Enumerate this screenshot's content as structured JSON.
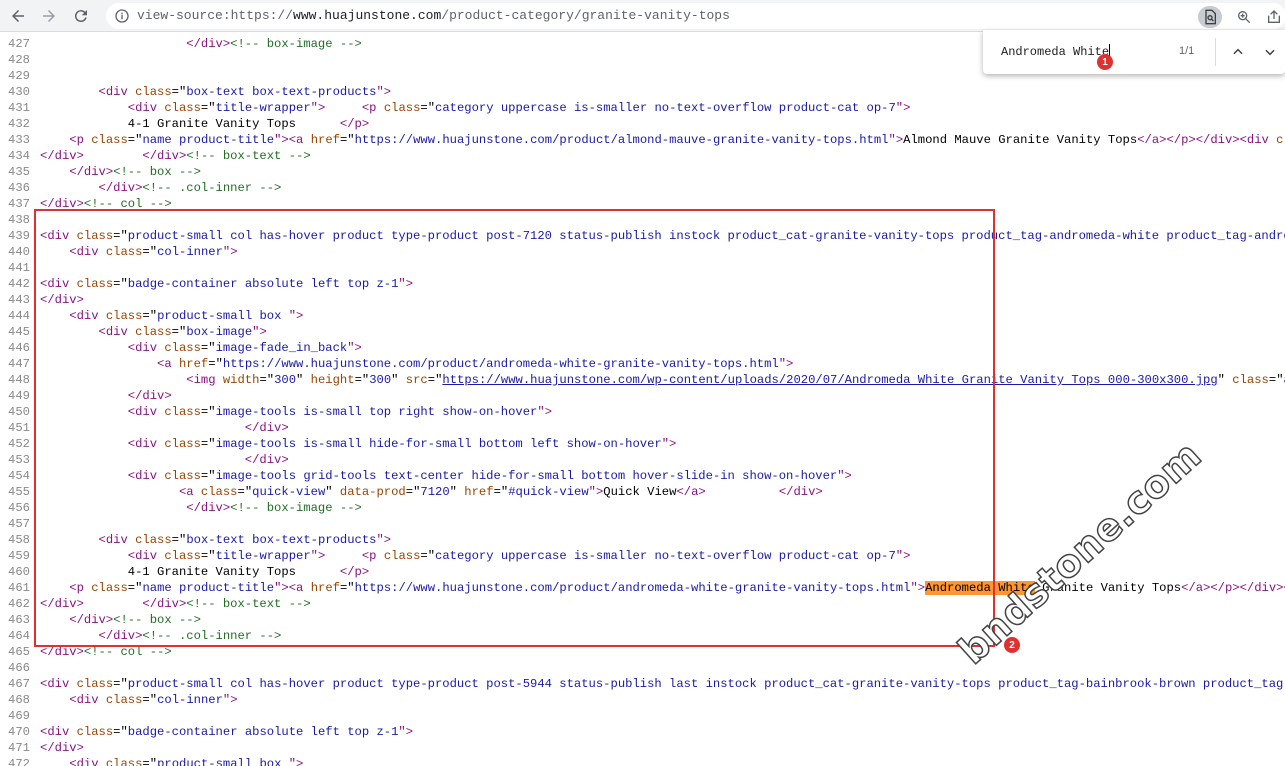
{
  "browser": {
    "url_prefix": "view-source:https://",
    "url_host": "www.huajunstone.com",
    "url_path": "/product-category/granite-vanity-tops"
  },
  "find_bar": {
    "query": "Andromeda White",
    "count": "1/1"
  },
  "annotations": {
    "marker_1": "1",
    "marker_2": "2",
    "watermark": "bndstone.com"
  },
  "source_lines": [
    {
      "num": "427",
      "segs": [
        {
          "s": "                    "
        },
        {
          "s": "</div>",
          "c": "t"
        },
        {
          "s": "<!-- box-image -->",
          "c": "c"
        }
      ]
    },
    {
      "num": "428",
      "segs": []
    },
    {
      "num": "429",
      "segs": []
    },
    {
      "num": "430",
      "segs": [
        {
          "s": "        "
        },
        {
          "s": "<div ",
          "c": "t"
        },
        {
          "s": "class",
          "c": "a"
        },
        {
          "s": "=\""
        },
        {
          "s": "box-text box-text-products",
          "c": "v"
        },
        {
          "s": "\">",
          "c": "t"
        }
      ]
    },
    {
      "num": "431",
      "segs": [
        {
          "s": "            "
        },
        {
          "s": "<div ",
          "c": "t"
        },
        {
          "s": "class",
          "c": "a"
        },
        {
          "s": "=\""
        },
        {
          "s": "title-wrapper",
          "c": "v"
        },
        {
          "s": "\">",
          "c": "t"
        },
        {
          "s": "     "
        },
        {
          "s": "<p ",
          "c": "t"
        },
        {
          "s": "class",
          "c": "a"
        },
        {
          "s": "=\""
        },
        {
          "s": "category uppercase is-smaller no-text-overflow product-cat op-7",
          "c": "v"
        },
        {
          "s": "\">",
          "c": "t"
        }
      ]
    },
    {
      "num": "432",
      "segs": [
        {
          "s": "            4-1 Granite Vanity Tops      "
        },
        {
          "s": "</p>",
          "c": "t"
        }
      ]
    },
    {
      "num": "433",
      "segs": [
        {
          "s": "    "
        },
        {
          "s": "<p ",
          "c": "t"
        },
        {
          "s": "class",
          "c": "a"
        },
        {
          "s": "=\""
        },
        {
          "s": "name product-title",
          "c": "v"
        },
        {
          "s": "\">",
          "c": "t"
        },
        {
          "s": "<a ",
          "c": "t"
        },
        {
          "s": "href",
          "c": "a"
        },
        {
          "s": "=\""
        },
        {
          "s": "https://www.huajunstone.com/product/almond-mauve-granite-vanity-tops.html",
          "c": "v"
        },
        {
          "s": "\">",
          "c": "t"
        },
        {
          "s": "Almond Mauve Granite Vanity Tops"
        },
        {
          "s": "</a></p></div>",
          "c": "t"
        },
        {
          "s": "<div ",
          "c": "t"
        },
        {
          "s": "class",
          "c": "a"
        },
        {
          "s": "=\""
        },
        {
          "s": "pr",
          "c": "v"
        }
      ]
    },
    {
      "num": "434",
      "segs": [
        {
          "s": "</div>",
          "c": "t"
        },
        {
          "s": "        "
        },
        {
          "s": "</div>",
          "c": "t"
        },
        {
          "s": "<!-- box-text -->",
          "c": "c"
        }
      ]
    },
    {
      "num": "435",
      "segs": [
        {
          "s": "    "
        },
        {
          "s": "</div>",
          "c": "t"
        },
        {
          "s": "<!-- box -->",
          "c": "c"
        }
      ]
    },
    {
      "num": "436",
      "segs": [
        {
          "s": "        "
        },
        {
          "s": "</div>",
          "c": "t"
        },
        {
          "s": "<!-- .col-inner -->",
          "c": "c"
        }
      ]
    },
    {
      "num": "437",
      "segs": [
        {
          "s": "</div>",
          "c": "t"
        },
        {
          "s": "<!-- col -->",
          "c": "c"
        }
      ]
    },
    {
      "num": "438",
      "segs": []
    },
    {
      "num": "439",
      "segs": [
        {
          "s": "<div ",
          "c": "t"
        },
        {
          "s": "class",
          "c": "a"
        },
        {
          "s": "=\""
        },
        {
          "s": "product-small col has-hover product type-product post-7120 status-publish instock product_cat-granite-vanity-tops product_tag-andromeda-white product_tag-andromeda-wh",
          "c": "v"
        }
      ]
    },
    {
      "num": "440",
      "segs": [
        {
          "s": "    "
        },
        {
          "s": "<div ",
          "c": "t"
        },
        {
          "s": "class",
          "c": "a"
        },
        {
          "s": "=\""
        },
        {
          "s": "col-inner",
          "c": "v"
        },
        {
          "s": "\">",
          "c": "t"
        }
      ]
    },
    {
      "num": "441",
      "segs": []
    },
    {
      "num": "442",
      "segs": [
        {
          "s": "<div ",
          "c": "t"
        },
        {
          "s": "class",
          "c": "a"
        },
        {
          "s": "=\""
        },
        {
          "s": "badge-container absolute left top z-1",
          "c": "v"
        },
        {
          "s": "\">",
          "c": "t"
        }
      ]
    },
    {
      "num": "443",
      "segs": [
        {
          "s": "</div>",
          "c": "t"
        }
      ]
    },
    {
      "num": "444",
      "segs": [
        {
          "s": "    "
        },
        {
          "s": "<div ",
          "c": "t"
        },
        {
          "s": "class",
          "c": "a"
        },
        {
          "s": "=\""
        },
        {
          "s": "product-small box ",
          "c": "v"
        },
        {
          "s": "\">",
          "c": "t"
        }
      ]
    },
    {
      "num": "445",
      "segs": [
        {
          "s": "        "
        },
        {
          "s": "<div ",
          "c": "t"
        },
        {
          "s": "class",
          "c": "a"
        },
        {
          "s": "=\""
        },
        {
          "s": "box-image",
          "c": "v"
        },
        {
          "s": "\">",
          "c": "t"
        }
      ]
    },
    {
      "num": "446",
      "segs": [
        {
          "s": "            "
        },
        {
          "s": "<div ",
          "c": "t"
        },
        {
          "s": "class",
          "c": "a"
        },
        {
          "s": "=\""
        },
        {
          "s": "image-fade_in_back",
          "c": "v"
        },
        {
          "s": "\">",
          "c": "t"
        }
      ]
    },
    {
      "num": "447",
      "segs": [
        {
          "s": "                "
        },
        {
          "s": "<a ",
          "c": "t"
        },
        {
          "s": "href",
          "c": "a"
        },
        {
          "s": "=\""
        },
        {
          "s": "https://www.huajunstone.com/product/andromeda-white-granite-vanity-tops.html",
          "c": "v"
        },
        {
          "s": "\">",
          "c": "t"
        }
      ]
    },
    {
      "num": "448",
      "segs": [
        {
          "s": "                    "
        },
        {
          "s": "<img ",
          "c": "t"
        },
        {
          "s": "width",
          "c": "a"
        },
        {
          "s": "=\""
        },
        {
          "s": "300",
          "c": "v"
        },
        {
          "s": "\" "
        },
        {
          "s": "height",
          "c": "a"
        },
        {
          "s": "=\""
        },
        {
          "s": "300",
          "c": "v"
        },
        {
          "s": "\" "
        },
        {
          "s": "src",
          "c": "a"
        },
        {
          "s": "=\""
        },
        {
          "s": "https://www.huajunstone.com/wp-content/uploads/2020/07/Andromeda White Granite Vanity Tops 000-300x300.jpg",
          "c": "lk"
        },
        {
          "s": "\" "
        },
        {
          "s": "class",
          "c": "a"
        },
        {
          "s": "=\""
        },
        {
          "s": "attachme",
          "c": "v"
        }
      ]
    },
    {
      "num": "449",
      "segs": [
        {
          "s": "            "
        },
        {
          "s": "</div>",
          "c": "t"
        }
      ]
    },
    {
      "num": "450",
      "segs": [
        {
          "s": "            "
        },
        {
          "s": "<div ",
          "c": "t"
        },
        {
          "s": "class",
          "c": "a"
        },
        {
          "s": "=\""
        },
        {
          "s": "image-tools is-small top right show-on-hover",
          "c": "v"
        },
        {
          "s": "\">",
          "c": "t"
        }
      ]
    },
    {
      "num": "451",
      "segs": [
        {
          "s": "                            "
        },
        {
          "s": "</div>",
          "c": "t"
        }
      ]
    },
    {
      "num": "452",
      "segs": [
        {
          "s": "            "
        },
        {
          "s": "<div ",
          "c": "t"
        },
        {
          "s": "class",
          "c": "a"
        },
        {
          "s": "=\""
        },
        {
          "s": "image-tools is-small hide-for-small bottom left show-on-hover",
          "c": "v"
        },
        {
          "s": "\">",
          "c": "t"
        }
      ]
    },
    {
      "num": "453",
      "segs": [
        {
          "s": "                            "
        },
        {
          "s": "</div>",
          "c": "t"
        }
      ]
    },
    {
      "num": "454",
      "segs": [
        {
          "s": "            "
        },
        {
          "s": "<div ",
          "c": "t"
        },
        {
          "s": "class",
          "c": "a"
        },
        {
          "s": "=\""
        },
        {
          "s": "image-tools grid-tools text-center hide-for-small bottom hover-slide-in show-on-hover",
          "c": "v"
        },
        {
          "s": "\">",
          "c": "t"
        }
      ]
    },
    {
      "num": "455",
      "segs": [
        {
          "s": "                   "
        },
        {
          "s": "<a ",
          "c": "t"
        },
        {
          "s": "class",
          "c": "a"
        },
        {
          "s": "=\""
        },
        {
          "s": "quick-view",
          "c": "v"
        },
        {
          "s": "\" "
        },
        {
          "s": "data-prod",
          "c": "a"
        },
        {
          "s": "=\""
        },
        {
          "s": "7120",
          "c": "v"
        },
        {
          "s": "\" "
        },
        {
          "s": "href",
          "c": "a"
        },
        {
          "s": "=\""
        },
        {
          "s": "#quick-view",
          "c": "v"
        },
        {
          "s": "\">",
          "c": "t"
        },
        {
          "s": "Quick View"
        },
        {
          "s": "</a>",
          "c": "t"
        },
        {
          "s": "          "
        },
        {
          "s": "</div>",
          "c": "t"
        }
      ]
    },
    {
      "num": "456",
      "segs": [
        {
          "s": "                    "
        },
        {
          "s": "</div>",
          "c": "t"
        },
        {
          "s": "<!-- box-image -->",
          "c": "c"
        }
      ]
    },
    {
      "num": "457",
      "segs": []
    },
    {
      "num": "458",
      "segs": [
        {
          "s": "        "
        },
        {
          "s": "<div ",
          "c": "t"
        },
        {
          "s": "class",
          "c": "a"
        },
        {
          "s": "=\""
        },
        {
          "s": "box-text box-text-products",
          "c": "v"
        },
        {
          "s": "\">",
          "c": "t"
        }
      ]
    },
    {
      "num": "459",
      "segs": [
        {
          "s": "            "
        },
        {
          "s": "<div ",
          "c": "t"
        },
        {
          "s": "class",
          "c": "a"
        },
        {
          "s": "=\""
        },
        {
          "s": "title-wrapper",
          "c": "v"
        },
        {
          "s": "\">",
          "c": "t"
        },
        {
          "s": "     "
        },
        {
          "s": "<p ",
          "c": "t"
        },
        {
          "s": "class",
          "c": "a"
        },
        {
          "s": "=\""
        },
        {
          "s": "category uppercase is-smaller no-text-overflow product-cat op-7",
          "c": "v"
        },
        {
          "s": "\">",
          "c": "t"
        }
      ]
    },
    {
      "num": "460",
      "segs": [
        {
          "s": "            4-1 Granite Vanity Tops      "
        },
        {
          "s": "</p>",
          "c": "t"
        }
      ]
    },
    {
      "num": "461",
      "segs": [
        {
          "s": "    "
        },
        {
          "s": "<p ",
          "c": "t"
        },
        {
          "s": "class",
          "c": "a"
        },
        {
          "s": "=\""
        },
        {
          "s": "name product-title",
          "c": "v"
        },
        {
          "s": "\">",
          "c": "t"
        },
        {
          "s": "<a ",
          "c": "t"
        },
        {
          "s": "href",
          "c": "a"
        },
        {
          "s": "=\""
        },
        {
          "s": "https://www.huajunstone.com/product/andromeda-white-granite-vanity-tops.html",
          "c": "v"
        },
        {
          "s": "\">",
          "c": "t"
        },
        {
          "s": "Andromeda White",
          "c": "hl"
        },
        {
          "s": " Granite Vanity Tops"
        },
        {
          "s": "</a></p></div>",
          "c": "t"
        },
        {
          "s": "<div ",
          "c": "t"
        },
        {
          "s": "cla",
          "c": "a"
        }
      ]
    },
    {
      "num": "462",
      "segs": [
        {
          "s": "</div>",
          "c": "t"
        },
        {
          "s": "        "
        },
        {
          "s": "</div>",
          "c": "t"
        },
        {
          "s": "<!-- box-text -->",
          "c": "c"
        }
      ]
    },
    {
      "num": "463",
      "segs": [
        {
          "s": "    "
        },
        {
          "s": "</div>",
          "c": "t"
        },
        {
          "s": "<!-- box -->",
          "c": "c"
        }
      ]
    },
    {
      "num": "464",
      "segs": [
        {
          "s": "        "
        },
        {
          "s": "</div>",
          "c": "t"
        },
        {
          "s": "<!-- .col-inner -->",
          "c": "c"
        }
      ]
    },
    {
      "num": "465",
      "segs": [
        {
          "s": "</div>",
          "c": "t"
        },
        {
          "s": "<!-- col -->",
          "c": "c"
        }
      ]
    },
    {
      "num": "466",
      "segs": []
    },
    {
      "num": "467",
      "segs": [
        {
          "s": "<div ",
          "c": "t"
        },
        {
          "s": "class",
          "c": "a"
        },
        {
          "s": "=\""
        },
        {
          "s": "product-small col has-hover product type-product post-5944 status-publish last instock product_cat-granite-vanity-tops product_tag-bainbrook-brown product_tag-bainbro",
          "c": "v"
        }
      ]
    },
    {
      "num": "468",
      "segs": [
        {
          "s": "    "
        },
        {
          "s": "<div ",
          "c": "t"
        },
        {
          "s": "class",
          "c": "a"
        },
        {
          "s": "=\""
        },
        {
          "s": "col-inner",
          "c": "v"
        },
        {
          "s": "\">",
          "c": "t"
        }
      ]
    },
    {
      "num": "469",
      "segs": []
    },
    {
      "num": "470",
      "segs": [
        {
          "s": "<div ",
          "c": "t"
        },
        {
          "s": "class",
          "c": "a"
        },
        {
          "s": "=\""
        },
        {
          "s": "badge-container absolute left top z-1",
          "c": "v"
        },
        {
          "s": "\">",
          "c": "t"
        }
      ]
    },
    {
      "num": "471",
      "segs": [
        {
          "s": "</div>",
          "c": "t"
        }
      ]
    },
    {
      "num": "472",
      "segs": [
        {
          "s": "    "
        },
        {
          "s": "<div ",
          "c": "t"
        },
        {
          "s": "class",
          "c": "a"
        },
        {
          "s": "=\""
        },
        {
          "s": "product-small box ",
          "c": "v"
        },
        {
          "s": "\">",
          "c": "t"
        }
      ]
    },
    {
      "num": "473",
      "segs": [
        {
          "s": "        "
        },
        {
          "s": "<div ",
          "c": "t"
        },
        {
          "s": "class",
          "c": "a"
        },
        {
          "s": "=\""
        },
        {
          "s": "box-image",
          "c": "v"
        },
        {
          "s": "\">",
          "c": "t"
        }
      ]
    }
  ],
  "icons": {
    "back": "arrow-left-icon",
    "forward": "arrow-right-icon",
    "reload": "reload-icon",
    "info": "info-icon",
    "find_in_page": "find-in-page-icon",
    "zoom": "zoom-icon",
    "share": "share-icon"
  },
  "colors": {
    "highlight": "#ff9632",
    "annotation_red": "#e03131",
    "tag": "#881280",
    "attr": "#994500",
    "value": "#1a1aa6",
    "comment": "#236e25"
  }
}
